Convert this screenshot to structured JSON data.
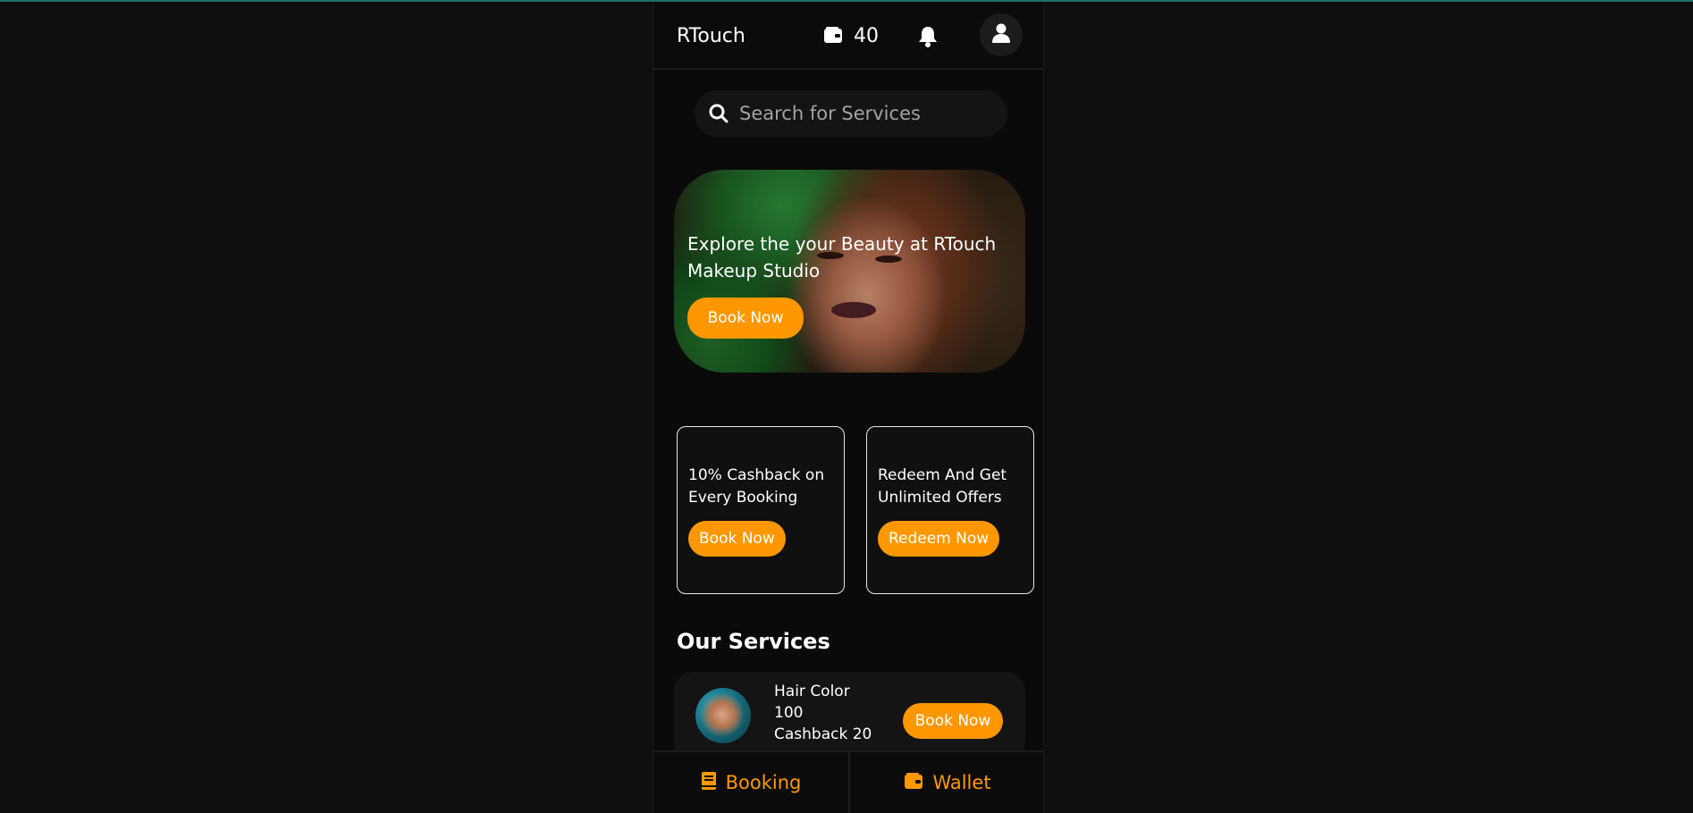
{
  "header": {
    "brand": "RTouch",
    "wallet_count": "40",
    "icons": {
      "wallet": "wallet-icon",
      "bell": "bell-icon",
      "profile": "user-icon"
    }
  },
  "search": {
    "placeholder": "Search for Services"
  },
  "hero": {
    "title": "Explore the your Beauty at RTouch Makeup Studio",
    "button_label": "Book Now"
  },
  "offers": [
    {
      "text": "10% Cashback on Every Booking",
      "button_label": "Book Now"
    },
    {
      "text": "Redeem And Get Unlimited Offers",
      "button_label": "Redeem Now"
    }
  ],
  "services": {
    "title": "Our Services",
    "items": [
      {
        "name": "Hair Color",
        "price": "100",
        "cashback": "Cashback 20",
        "button_label": "Book Now"
      }
    ]
  },
  "bottom_nav": {
    "items": [
      {
        "label": "Booking",
        "icon": "book-icon"
      },
      {
        "label": "Wallet",
        "icon": "wallet-icon"
      }
    ]
  },
  "colors": {
    "accent": "#ff9800",
    "background": "#0f0f0f",
    "card": "#141414"
  }
}
